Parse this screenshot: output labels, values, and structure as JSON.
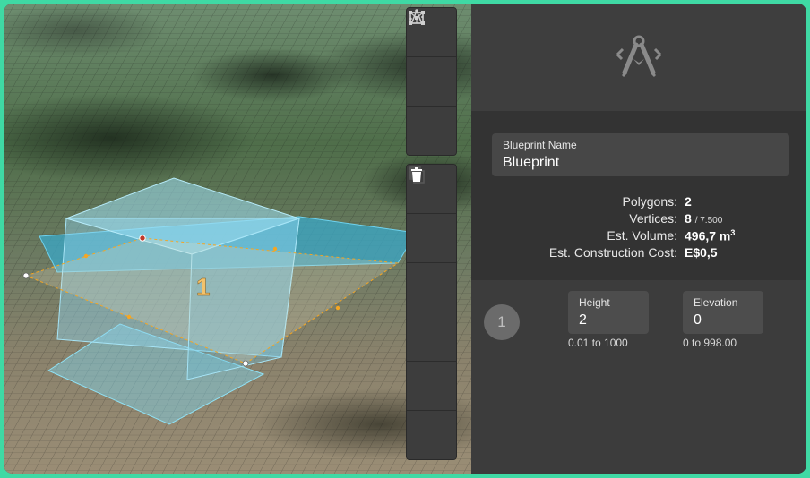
{
  "viewport": {
    "polygon_label": "1"
  },
  "toolbar": {
    "top_group": [
      {
        "name": "draw-polygon-icon"
      },
      {
        "name": "edit-vertices-icon"
      },
      {
        "name": "select-shape-icon"
      }
    ],
    "bottom_group": [
      {
        "name": "union-icon",
        "enabled": false
      },
      {
        "name": "subtract-icon",
        "enabled": false
      },
      {
        "name": "intersect-icon",
        "enabled": false
      },
      {
        "name": "exclude-icon",
        "enabled": false
      },
      {
        "name": "duplicate-icon",
        "enabled": false
      },
      {
        "name": "trash-icon",
        "enabled": true
      }
    ]
  },
  "panel": {
    "header_icon": "blueprint-compass-icon",
    "name_label": "Blueprint Name",
    "name_value": "Blueprint",
    "stats": {
      "polygons_label": "Polygons:",
      "polygons_value": "2",
      "vertices_label": "Vertices:",
      "vertices_value": "8",
      "vertices_limit": "/ 7.500",
      "volume_label": "Est. Volume:",
      "volume_value": "496,7 m",
      "volume_unit_sup": "3",
      "cost_label": "Est. Construction Cost:",
      "cost_value": "E$0,5"
    },
    "polygon": {
      "index": "1",
      "height_label": "Height",
      "height_value": "2",
      "height_range": "0.01 to 1000",
      "elevation_label": "Elevation",
      "elevation_value": "0",
      "elevation_range": "0 to 998.00"
    }
  },
  "colors": {
    "accent_frame": "#3fd9a4",
    "shape_fill": "#7fd6ef",
    "handle_orange": "#f5a623"
  }
}
